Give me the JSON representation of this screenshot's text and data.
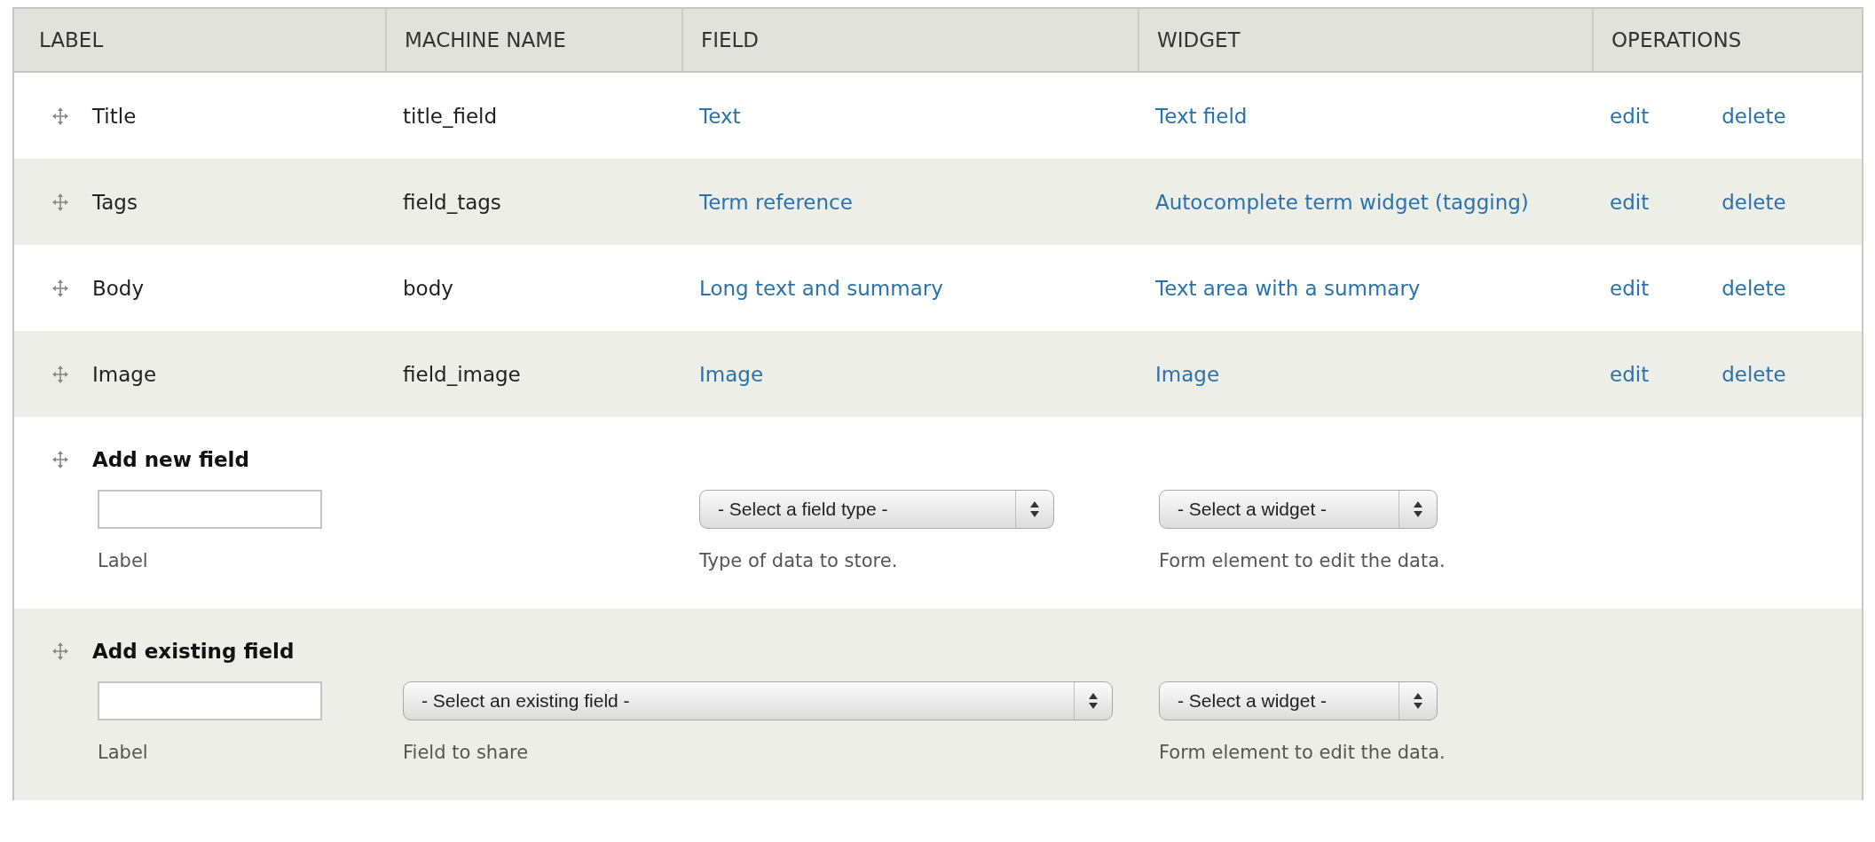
{
  "table": {
    "columns": [
      "LABEL",
      "MACHINE NAME",
      "FIELD",
      "WIDGET",
      "OPERATIONS"
    ],
    "rows": [
      {
        "label": "Title",
        "machine_name": "title_field",
        "field": "Text",
        "widget": "Text field",
        "operations": [
          "edit",
          "delete"
        ]
      },
      {
        "label": "Tags",
        "machine_name": "field_tags",
        "field": "Term reference",
        "widget": "Autocomplete term widget (tagging)",
        "operations": [
          "edit",
          "delete"
        ]
      },
      {
        "label": "Body",
        "machine_name": "body",
        "field": "Long text and summary",
        "widget": "Text area with a summary",
        "operations": [
          "edit",
          "delete"
        ]
      },
      {
        "label": "Image",
        "machine_name": "field_image",
        "field": "Image",
        "widget": "Image",
        "operations": [
          "edit",
          "delete"
        ]
      }
    ],
    "add_rows": [
      {
        "kind": "new",
        "title": "Add new field",
        "label_caption": "Label",
        "field_select": "- Select a field type -",
        "field_caption": "Type of data to store.",
        "widget_select": "- Select a widget -",
        "widget_caption": "Form element to edit the data."
      },
      {
        "kind": "existing",
        "title": "Add existing field",
        "label_caption": "Label",
        "field_select": "- Select an existing field -",
        "field_caption": "Field to share",
        "widget_select": "- Select a widget -",
        "widget_caption": "Form element to edit the data."
      }
    ]
  }
}
